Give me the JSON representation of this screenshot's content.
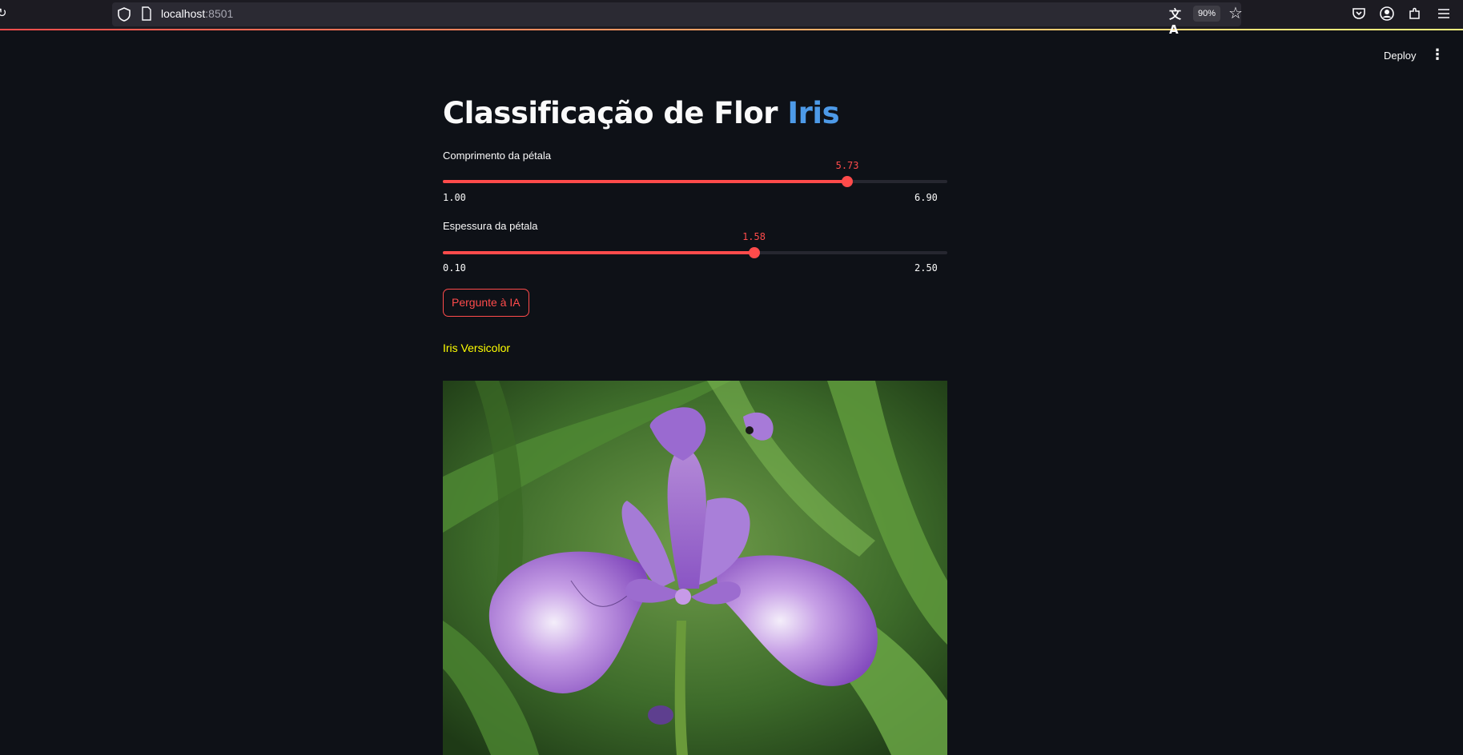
{
  "browser": {
    "url_host": "localhost",
    "url_port": ":8501",
    "zoom": "90%"
  },
  "header": {
    "deploy_label": "Deploy",
    "menu_icon": "kebab-vertical-icon"
  },
  "main": {
    "title_prefix": "Classificação de Flor ",
    "title_highlight": "Iris",
    "title_highlight_color": "#4d9ae8",
    "sliders": [
      {
        "label": "Comprimento da pétala",
        "value": "5.73",
        "min": "1.00",
        "max": "6.90",
        "fraction": 0.8017
      },
      {
        "label": "Espessura da pétala",
        "value": "1.58",
        "min": "0.10",
        "max": "2.50",
        "fraction": 0.6167
      }
    ],
    "ask_button_label": "Pergunte à IA",
    "result": "Iris Versicolor",
    "result_color": "#ffff00",
    "accent_color": "#ff4b4b"
  }
}
